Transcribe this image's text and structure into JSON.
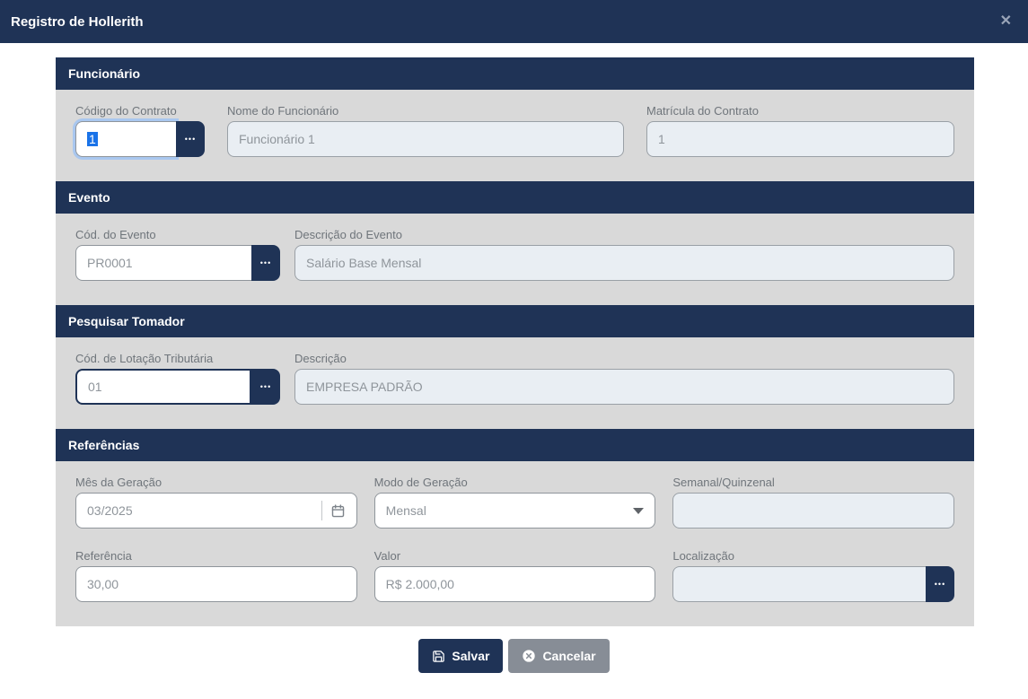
{
  "modal": {
    "title": "Registro de Hollerith",
    "close_glyph": "✕"
  },
  "icons": {
    "ellipsis": "•••"
  },
  "sections": {
    "funcionario": {
      "title": "Funcionário",
      "codigo_contrato": {
        "label": "Código do Contrato",
        "value": "1"
      },
      "nome_funcionario": {
        "label": "Nome do Funcionário",
        "value": "Funcionário 1"
      },
      "matricula_contrato": {
        "label": "Matrícula do Contrato",
        "value": "1"
      }
    },
    "evento": {
      "title": "Evento",
      "cod_evento": {
        "label": "Cód. do Evento",
        "value": "PR0001"
      },
      "descricao_evento": {
        "label": "Descrição do Evento",
        "value": "Salário Base Mensal"
      }
    },
    "tomador": {
      "title": "Pesquisar Tomador",
      "cod_lotacao": {
        "label": "Cód. de Lotação Tributária",
        "value": "01"
      },
      "descricao": {
        "label": "Descrição",
        "value": "EMPRESA PADRÃO"
      }
    },
    "referencias": {
      "title": "Referências",
      "mes_geracao": {
        "label": "Mês da Geração",
        "value": "03/2025"
      },
      "modo_geracao": {
        "label": "Modo de Geração",
        "value": "Mensal"
      },
      "semanal_quinzenal": {
        "label": "Semanal/Quinzenal",
        "value": ""
      },
      "referencia": {
        "label": "Referência",
        "value": "30,00"
      },
      "valor": {
        "label": "Valor",
        "value": "R$ 2.000,00"
      },
      "localizacao": {
        "label": "Localização",
        "value": ""
      }
    }
  },
  "footer": {
    "save": "Salvar",
    "cancel": "Cancelar"
  },
  "colors": {
    "navy": "#1f3356",
    "panel_gray": "#d9d9d9",
    "disabled_bg": "#e9eef3",
    "selection_blue": "#1a73e8",
    "focus_ring": "#a9c7ef",
    "cancel_gray": "#878d96"
  }
}
